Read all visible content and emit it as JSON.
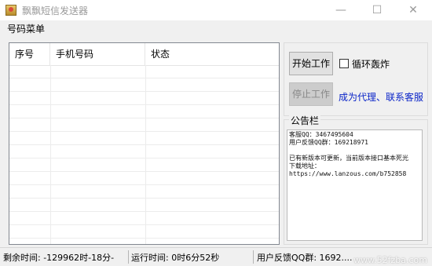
{
  "window": {
    "title": "飘飘短信发送器",
    "minimize_glyph": "—",
    "maximize_glyph": "☐",
    "close_glyph": "✕"
  },
  "menu": {
    "items": [
      {
        "label": "号码菜单"
      }
    ]
  },
  "table": {
    "columns": [
      "序号",
      "手机号码",
      "状态"
    ],
    "rows": []
  },
  "controls": {
    "start_label": "开始工作",
    "stop_label": "停止工作",
    "loop_label": "循环轰炸",
    "loop_checked": false,
    "agent_link": "成为代理、联系客服"
  },
  "notice": {
    "title": "公告栏",
    "text": "客服QQ：3467495604\n用户反馈QQ群：169218971\n\n已有新版本可更新，当前版本接口基本死光\n下载地址：\nhttps://www.lanzous.com/b752858"
  },
  "status": {
    "remaining": "剩余时间:  -129962时-18分-",
    "running": "运行时间:  0时6分52秒",
    "feedback": "用户反馈QQ群:  1692...."
  },
  "watermark": "www.52fzba.com",
  "colors": {
    "link": "#0a24c8",
    "background": "#f0f0f0"
  }
}
